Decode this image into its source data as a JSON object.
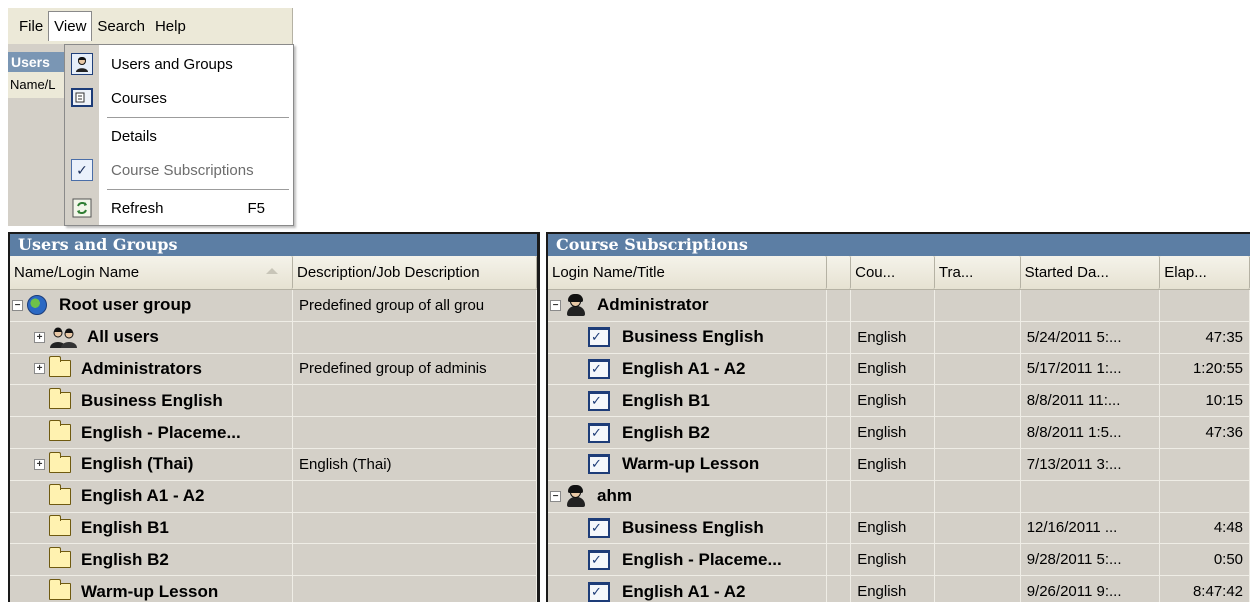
{
  "menubar": {
    "items": [
      "File",
      "View",
      "Search",
      "Help"
    ]
  },
  "behind": {
    "title": "Users",
    "header": "Name/L"
  },
  "view_menu": {
    "items": [
      {
        "label": "Users and Groups",
        "icon": "users-groups-icon",
        "shortcut": ""
      },
      {
        "label": "Courses",
        "icon": "courses-icon",
        "shortcut": ""
      },
      {
        "label": "Details",
        "icon": "",
        "shortcut": ""
      },
      {
        "label": "Course Subscriptions",
        "icon": "check-icon",
        "shortcut": "",
        "checked": true,
        "disabled": true
      },
      {
        "label": "Refresh",
        "icon": "refresh-icon",
        "shortcut": "F5"
      }
    ]
  },
  "users_panel": {
    "title": "Users and Groups",
    "columns": [
      "Name/Login Name",
      "Description/Job Description"
    ],
    "rows": [
      {
        "name": "Root user group",
        "desc": "Predefined group of all grou",
        "icon": "globe-icon",
        "toggle": "−",
        "level": 0
      },
      {
        "name": "All users",
        "desc": "",
        "icon": "users-icon",
        "toggle": "+",
        "level": 1
      },
      {
        "name": "Administrators",
        "desc": "Predefined group of adminis",
        "icon": "folder-icon",
        "toggle": "+",
        "level": 1
      },
      {
        "name": "Business English",
        "desc": "",
        "icon": "folder-icon",
        "toggle": "",
        "level": 1
      },
      {
        "name": "English - Placeme...",
        "desc": "",
        "icon": "folder-icon",
        "toggle": "",
        "level": 1
      },
      {
        "name": "English (Thai)",
        "desc": "English (Thai)",
        "icon": "folder-icon",
        "toggle": "+",
        "level": 1
      },
      {
        "name": "English A1 - A2",
        "desc": "",
        "icon": "folder-icon",
        "toggle": "",
        "level": 1
      },
      {
        "name": "English B1",
        "desc": "",
        "icon": "folder-icon",
        "toggle": "",
        "level": 1
      },
      {
        "name": "English B2",
        "desc": "",
        "icon": "folder-icon",
        "toggle": "",
        "level": 1
      },
      {
        "name": "Warm-up Lesson",
        "desc": "",
        "icon": "folder-icon",
        "toggle": "",
        "level": 1
      }
    ]
  },
  "subs_panel": {
    "title": "Course Subscriptions",
    "columns": [
      "Login Name/Title",
      "",
      "Cou...",
      "Tra...",
      "Started Da...",
      "Elap..."
    ],
    "rows": [
      {
        "name": "Administrator",
        "type": "user",
        "course": "",
        "tra": "",
        "started": "",
        "elapsed": ""
      },
      {
        "name": "Business English",
        "type": "course",
        "course": "English",
        "tra": "",
        "started": "5/24/2011 5:...",
        "elapsed": "47:35"
      },
      {
        "name": "English A1 - A2",
        "type": "course",
        "course": "English",
        "tra": "",
        "started": "5/17/2011 1:...",
        "elapsed": "1:20:55"
      },
      {
        "name": "English B1",
        "type": "course",
        "course": "English",
        "tra": "",
        "started": "8/8/2011 11:...",
        "elapsed": "10:15"
      },
      {
        "name": "English B2",
        "type": "course",
        "course": "English",
        "tra": "",
        "started": "8/8/2011 1:5...",
        "elapsed": "47:36"
      },
      {
        "name": "Warm-up Lesson",
        "type": "course",
        "course": "English",
        "tra": "",
        "started": "7/13/2011 3:...",
        "elapsed": ""
      },
      {
        "name": "ahm",
        "type": "user",
        "course": "",
        "tra": "",
        "started": "",
        "elapsed": ""
      },
      {
        "name": "Business English",
        "type": "course",
        "course": "English",
        "tra": "",
        "started": "12/16/2011 ...",
        "elapsed": "4:48"
      },
      {
        "name": "English - Placeme...",
        "type": "course",
        "course": "English",
        "tra": "",
        "started": "9/28/2011 5:...",
        "elapsed": "0:50"
      },
      {
        "name": "English A1 - A2",
        "type": "course",
        "course": "English",
        "tra": "",
        "started": "9/26/2011 9:...",
        "elapsed": "8:47:42"
      }
    ]
  },
  "colors": {
    "panel_title_bg": "#5c7ea4",
    "chrome_bg": "#d4d0c8",
    "header_bg": "#ece9d8"
  }
}
